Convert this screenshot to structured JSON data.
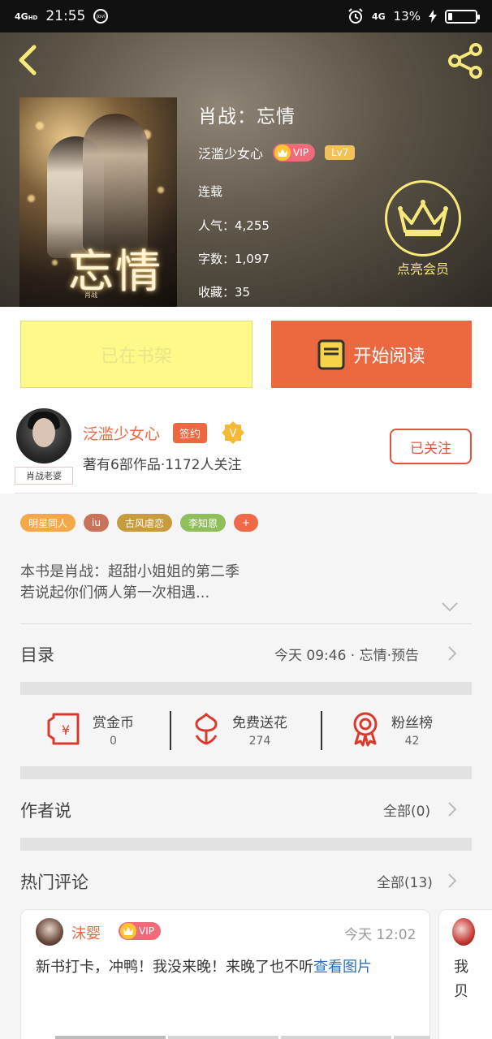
{
  "status": {
    "network_left": "4G",
    "network_hd": "HD",
    "time": "21:55",
    "jovi": "Jovi",
    "network_right": "4G",
    "battery": "13%"
  },
  "book": {
    "title": "肖战：忘情",
    "author": "泛滥少女心",
    "vip": "VIP",
    "level": "Lv7",
    "status": "连载",
    "popularity": "人气：4,255",
    "word_count": "字数：1,097",
    "favorites": "收藏：35",
    "cover_title": "忘情",
    "cover_small": "肖战",
    "member_label": "点亮会员"
  },
  "actions": {
    "shelf_label": "已在书架",
    "read_label": "开始阅读"
  },
  "author": {
    "name": "泛滥少女心",
    "sign": "签约",
    "v": "V",
    "tag": "肖战老婆",
    "works": "著有6部作品·1172人关注",
    "follow": "已关注"
  },
  "tags": [
    {
      "label": "明星同人",
      "color": "#f3a94a"
    },
    {
      "label": "iu",
      "color": "#c9735a"
    },
    {
      "label": "古风虐恋",
      "color": "#c99b3f"
    },
    {
      "label": "李知恩",
      "color": "#8fbf5a"
    },
    {
      "label": "+",
      "color": "#f06a4a"
    }
  ],
  "intro": {
    "line1": "本书是肖战：超甜小姐姐的第二季",
    "line2": "若说起你们俩人第一次相遇..."
  },
  "catalog": {
    "title": "目录",
    "latest": "今天 09:46 · 忘情·预告"
  },
  "rewards": [
    {
      "label": "赏金币",
      "value": "0"
    },
    {
      "label": "免费送花",
      "value": "274"
    },
    {
      "label": "粉丝榜",
      "value": "42"
    }
  ],
  "author_says": {
    "title": "作者说",
    "all": "全部(0)"
  },
  "hot_comments": {
    "title": "热门评论",
    "all": "全部(13)",
    "items": [
      {
        "user": "沫婴",
        "vip": "VIP",
        "time": "今天 12:02",
        "text": "新书打卡，冲鸭！我没来晚！来晚了也不听",
        "link": "查看图片"
      }
    ],
    "next_preview": "我贝"
  },
  "colors": {
    "accent": "#ec6840",
    "shelf_bg": "#fff98a",
    "member": "#f6e87a"
  }
}
